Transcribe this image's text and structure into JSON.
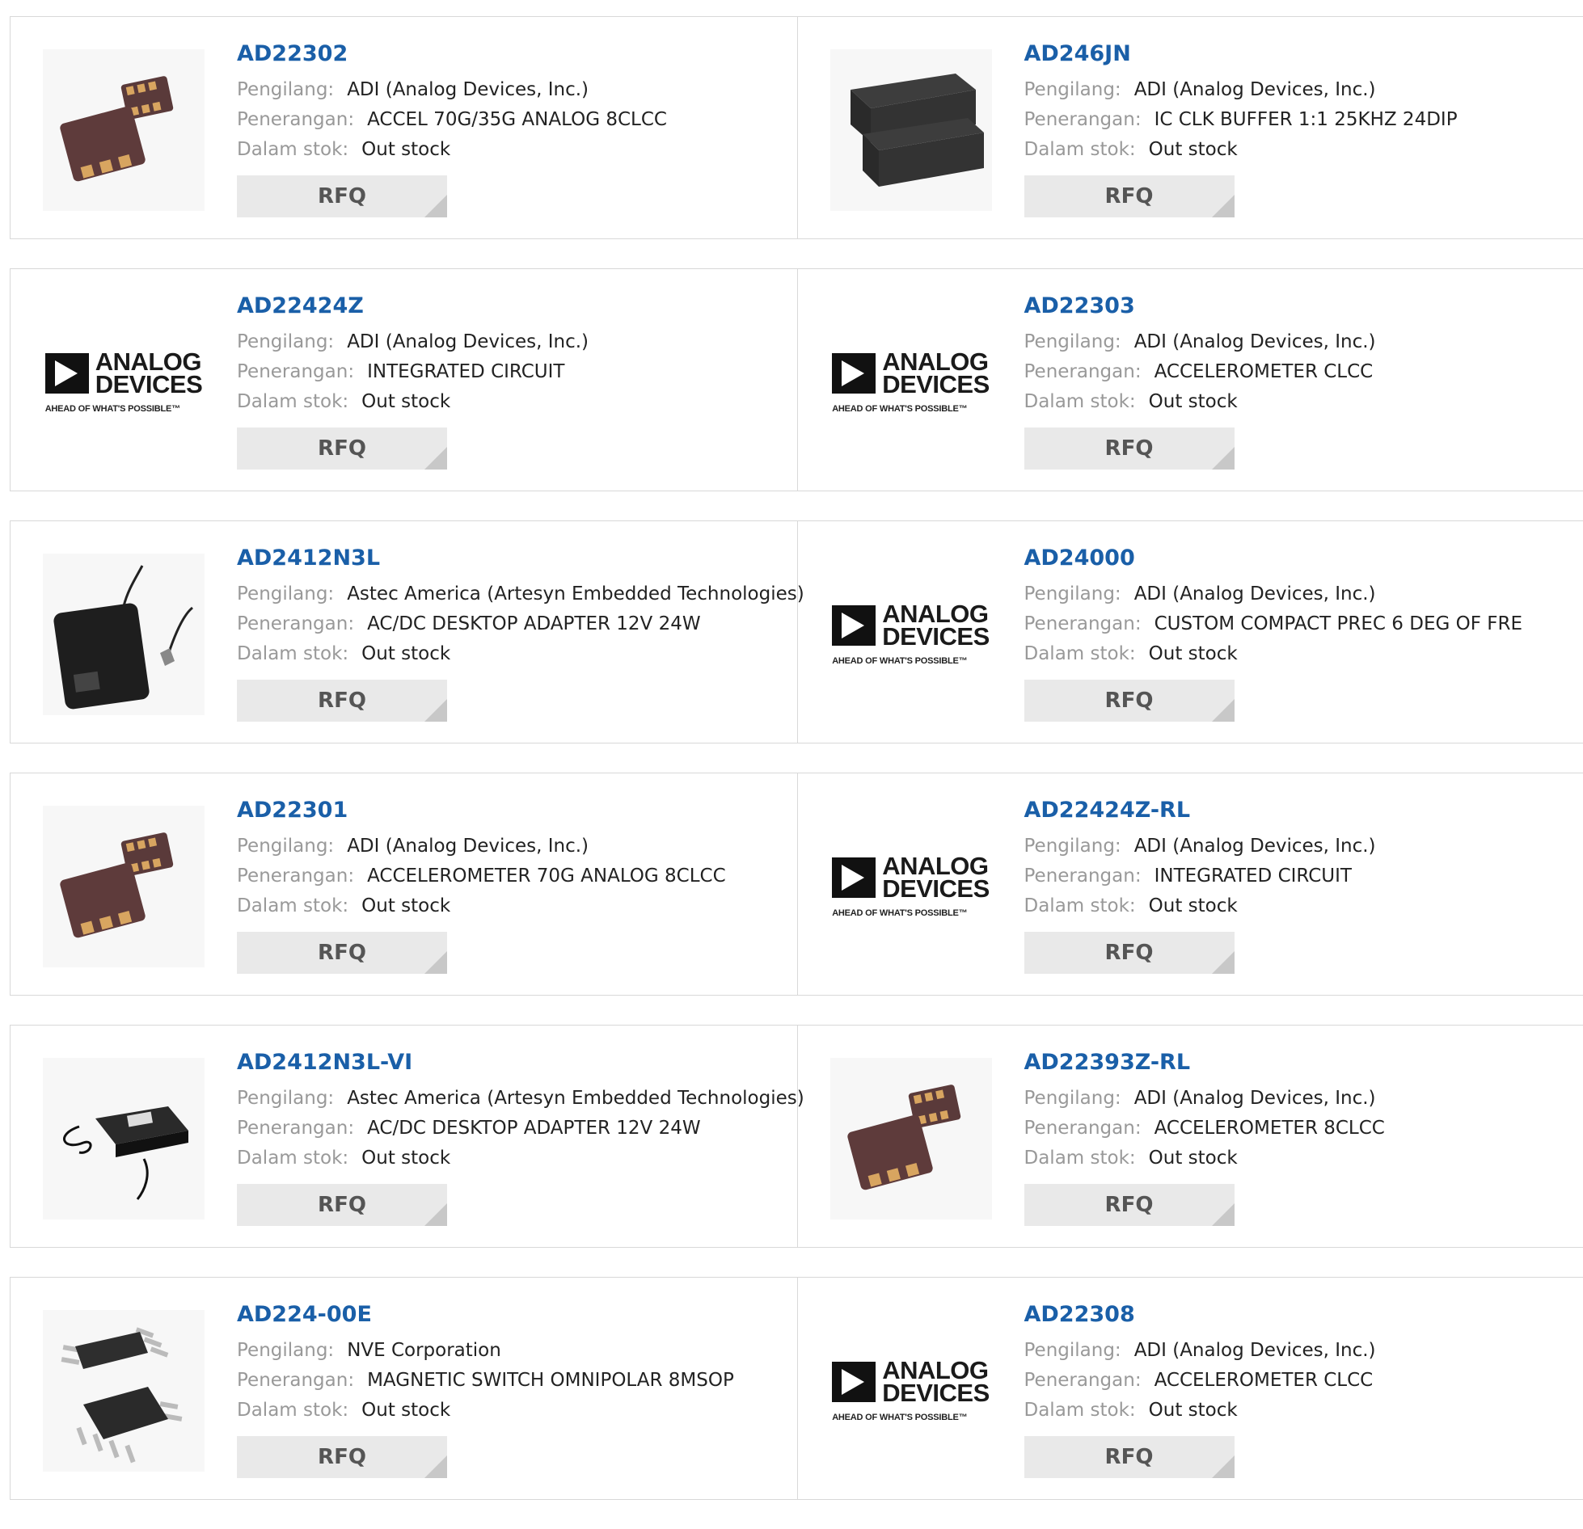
{
  "labels": {
    "manufacturer": "Pengilang:",
    "description": "Penerangan:",
    "stock": "Dalam stok:",
    "rfq": "RFQ"
  },
  "products": [
    {
      "part": "AD22302",
      "manufacturer": "ADI (Analog Devices, Inc.)",
      "description": "ACCEL 70G/35G ANALOG 8CLCC",
      "stock": "Out stock",
      "image": "clcc-chip-image"
    },
    {
      "part": "AD246JN",
      "manufacturer": "ADI (Analog Devices, Inc.)",
      "description": "IC CLK BUFFER 1:1 25KHZ 24DIP",
      "stock": "Out stock",
      "image": "dip-module-image"
    },
    {
      "part": "AD22424Z",
      "manufacturer": "ADI (Analog Devices, Inc.)",
      "description": "INTEGRATED CIRCUIT",
      "stock": "Out stock",
      "image": "analog-devices-logo"
    },
    {
      "part": "AD22303",
      "manufacturer": "ADI (Analog Devices, Inc.)",
      "description": "ACCELEROMETER CLCC",
      "stock": "Out stock",
      "image": "analog-devices-logo"
    },
    {
      "part": "AD2412N3L",
      "manufacturer": "Astec America (Artesyn Embedded Technologies)",
      "description": "AC/DC DESKTOP ADAPTER 12V 24W",
      "stock": "Out stock",
      "image": "adapter-image"
    },
    {
      "part": "AD24000",
      "manufacturer": "ADI (Analog Devices, Inc.)",
      "description": "CUSTOM COMPACT PREC 6 DEG OF FRE",
      "stock": "Out stock",
      "image": "analog-devices-logo"
    },
    {
      "part": "AD22301",
      "manufacturer": "ADI (Analog Devices, Inc.)",
      "description": "ACCELEROMETER 70G ANALOG 8CLCC",
      "stock": "Out stock",
      "image": "clcc-chip-image"
    },
    {
      "part": "AD22424Z-RL",
      "manufacturer": "ADI (Analog Devices, Inc.)",
      "description": "INTEGRATED CIRCUIT",
      "stock": "Out stock",
      "image": "analog-devices-logo"
    },
    {
      "part": "AD2412N3L-VI",
      "manufacturer": "Astec America (Artesyn Embedded Technologies)",
      "description": "AC/DC DESKTOP ADAPTER 12V 24W",
      "stock": "Out stock",
      "image": "adapter-small-image"
    },
    {
      "part": "AD22393Z-RL",
      "manufacturer": "ADI (Analog Devices, Inc.)",
      "description": "ACCELEROMETER 8CLCC",
      "stock": "Out stock",
      "image": "clcc-chip-image"
    },
    {
      "part": "AD224-00E",
      "manufacturer": "NVE Corporation",
      "description": "MAGNETIC SWITCH OMNIPOLAR 8MSOP",
      "stock": "Out stock",
      "image": "msop-chip-image"
    },
    {
      "part": "AD22308",
      "manufacturer": "ADI (Analog Devices, Inc.)",
      "description": "ACCELEROMETER CLCC",
      "stock": "Out stock",
      "image": "analog-devices-logo"
    }
  ],
  "logo": {
    "line1": "ANALOG",
    "line2": "DEVICES",
    "tagline": "AHEAD OF WHAT'S POSSIBLE™"
  },
  "colors": {
    "link": "#1a5fa8",
    "label": "#999999",
    "button_bg": "#e9e9e9",
    "border": "#d8d8d8"
  }
}
